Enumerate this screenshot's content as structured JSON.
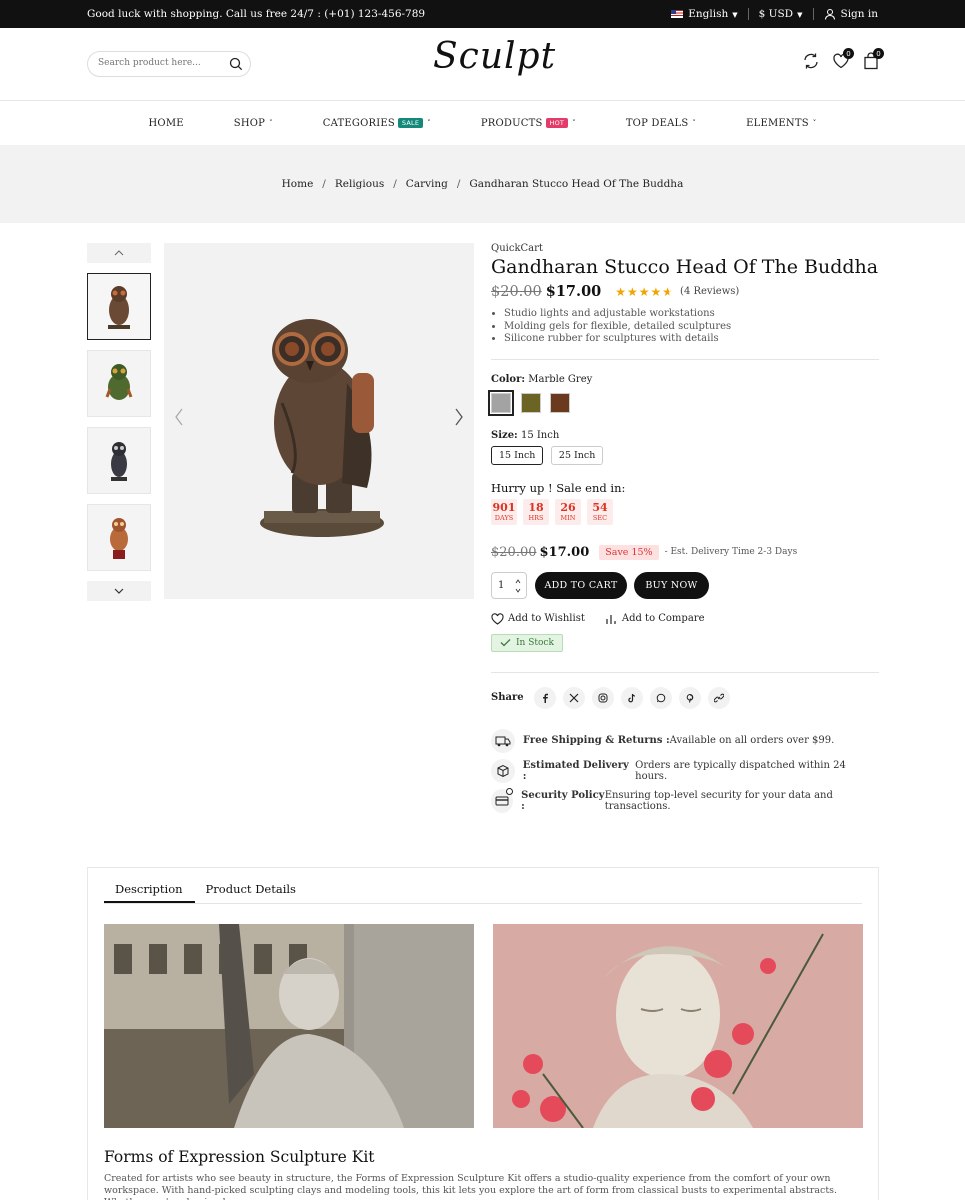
{
  "topbar": {
    "message": "Good luck with shopping. Call us free 24/7 : (+01) 123-456-789",
    "language": "English",
    "currency": "$ USD",
    "signin": "Sign in"
  },
  "header": {
    "logo": "Sculpt",
    "search_placeholder": "Search product here...",
    "wishlist_count": "0",
    "cart_count": "0"
  },
  "nav": [
    {
      "label": "HOME",
      "caret": ""
    },
    {
      "label": "SHOP",
      "caret": "˅"
    },
    {
      "label": "CATEGORIES",
      "tag": "SALE",
      "tag_color": "#14897a",
      "caret": "˅"
    },
    {
      "label": "PRODUCTS",
      "tag": "HOT",
      "tag_color": "#e23c6a",
      "caret": "˅"
    },
    {
      "label": "TOP DEALS",
      "caret": "˅"
    },
    {
      "label": "ELEMENTS",
      "caret": "˅"
    }
  ],
  "breadcrumb": [
    "Home",
    "Religious",
    "Carving",
    "Gandharan Stucco Head Of The Buddha"
  ],
  "product": {
    "brand": "QuickCart",
    "title": "Gandharan Stucco Head Of The Buddha",
    "old_price": "$20.00",
    "new_price": "$17.00",
    "rating": 4.5,
    "reviews": "(4 Reviews)",
    "features": [
      "Studio lights and adjustable workstations",
      "Molding gels for flexible, detailed sculptures",
      "Silicone rubber for sculptures with details"
    ],
    "color_label": "Color:",
    "color_value": "Marble Grey",
    "colors": [
      "#a3a3a3",
      "#6b6424",
      "#6b3a1e"
    ],
    "size_label": "Size:",
    "size_value": "15 Inch",
    "sizes": [
      "15 Inch",
      "25 Inch"
    ],
    "hurry": "Hurry up ! Sale end in:",
    "countdown": [
      {
        "v": "901",
        "l": "DAYS"
      },
      {
        "v": "18",
        "l": "HRS"
      },
      {
        "v": "26",
        "l": "MIN"
      },
      {
        "v": "54",
        "l": "SEC"
      }
    ],
    "save": "Save 15%",
    "delivery_est": "- Est. Delivery Time 2-3 Days",
    "qty": "1",
    "add_to_cart": "ADD TO CART",
    "buy_now": "BUY NOW",
    "wishlist": "Add to Wishlist",
    "compare": "Add to Compare",
    "stock": "In Stock",
    "share_label": "Share"
  },
  "policies": [
    {
      "title": "Free Shipping & Returns :",
      "text": " Available on all orders over $99."
    },
    {
      "title": "Estimated Delivery :",
      "text": " Orders are typically dispatched within 24 hours."
    },
    {
      "title": "Security Policy :",
      "text": " Ensuring top-level security for your data and transactions."
    }
  ],
  "tabs": [
    "Description",
    "Product Details"
  ],
  "description": {
    "title": "Forms of Expression Sculpture Kit",
    "text": "Created for artists who see beauty in structure, the Forms of Expression Sculpture Kit offers a studio-quality experience from the comfort of your own workspace. With hand-picked sculpting clays and modeling tools, this kit lets you explore the art of form from classical busts to experimental abstracts. Whether you're shaping by"
  },
  "colors": {
    "topbar": "#111111",
    "accent": "#111111",
    "sale": "#14897a",
    "hot": "#e23c6a",
    "price_red": "#dd3333"
  }
}
